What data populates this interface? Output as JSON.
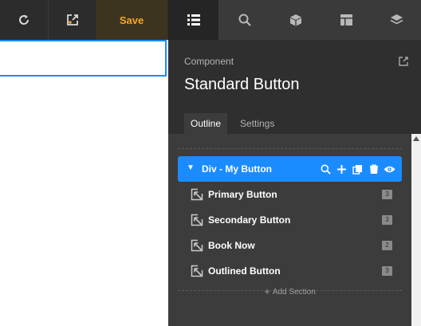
{
  "toolbar": {
    "save_label": "Save",
    "icons": [
      "refresh-icon",
      "open-external-icon"
    ],
    "accent": "#f5a623"
  },
  "panel_tabs": [
    {
      "name": "outline-list-icon",
      "active": true
    },
    {
      "name": "search-icon",
      "active": false
    },
    {
      "name": "cube-icon",
      "active": false
    },
    {
      "name": "layout-icon",
      "active": false
    },
    {
      "name": "layers-icon",
      "active": false
    }
  ],
  "component": {
    "label": "Component",
    "title": "Standard Button"
  },
  "sub_tabs": {
    "outline": "Outline",
    "settings": "Settings"
  },
  "outline": {
    "root": {
      "label": "Div - My Button",
      "color": "#1a8cff"
    },
    "children": [
      {
        "label": "Primary Button",
        "badge": "3"
      },
      {
        "label": "Secondary Button",
        "badge": "3"
      },
      {
        "label": "Book Now",
        "badge": "2"
      },
      {
        "label": "Outlined Button",
        "badge": "3"
      }
    ],
    "add_section": "Add Section"
  }
}
